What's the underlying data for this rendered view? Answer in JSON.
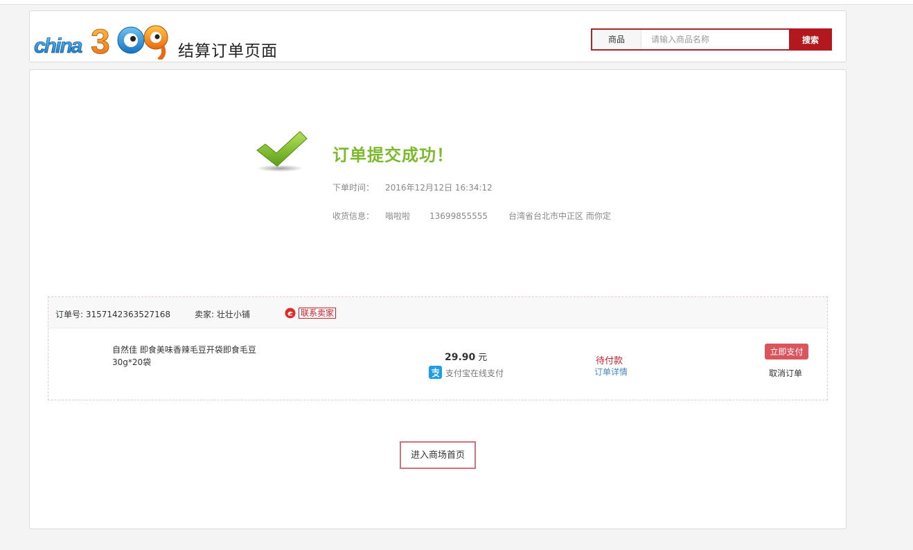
{
  "header": {
    "logo_text": "china360",
    "page_title": "结算订单页面"
  },
  "search": {
    "category": "商品",
    "placeholder": "请输入商品名称",
    "button": "搜索"
  },
  "result": {
    "title": "订单提交成功！",
    "time_label": "下单时间：",
    "time_value": "2016年12月12日 16:34:12",
    "addr_label": "收货信息：",
    "receiver": "嗡啦啦",
    "phone": "13699855555",
    "address": "台湾省台北市中正区 而你定"
  },
  "order": {
    "no_label": "订单号:",
    "no": "3157142363527168",
    "seller_label": "卖家:",
    "seller": "壮壮小铺",
    "contact": "联系卖家",
    "goods_name": "自然佳 即食美味香辣毛豆开袋即食毛豆30g*20袋",
    "price": "29.90",
    "price_unit": "元",
    "pay_method": "支付宝在线支付",
    "status": "待付款",
    "detail": "订单详情",
    "pay_button": "立即支付",
    "cancel": "取消订单"
  },
  "home_button": "进入商场首页",
  "colors": {
    "brand_red": "#b1191e",
    "success_green": "#7cba2c",
    "pay_button": "#d9565e",
    "link_blue": "#4a86c4"
  },
  "icons": [
    "china360-logo",
    "check-icon",
    "contact-seller-icon",
    "alipay-icon"
  ]
}
